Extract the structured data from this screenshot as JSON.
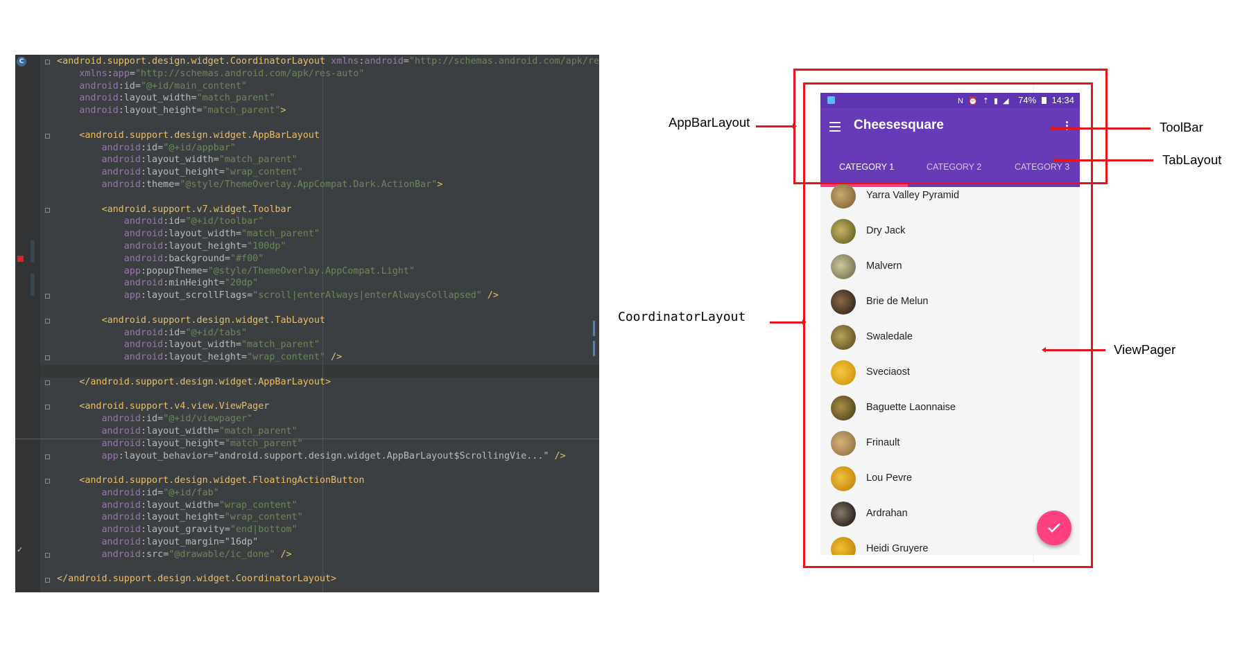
{
  "editor": {
    "lines": [
      {
        "fold": true,
        "parts": [
          [
            "p",
            "<"
          ],
          [
            "t",
            "android.support.design.widget.CoordinatorLayout"
          ],
          [
            "x",
            " "
          ],
          [
            "ns",
            "xmlns"
          ],
          [
            "a",
            ":"
          ],
          [
            "ns",
            "android"
          ],
          [
            "a",
            "="
          ],
          [
            "v",
            "\"http://schemas.android.com/apk/res"
          ]
        ]
      },
      {
        "parts": [
          [
            "x",
            "    "
          ],
          [
            "ns",
            "xmlns"
          ],
          [
            "a",
            ":"
          ],
          [
            "ns",
            "app"
          ],
          [
            "a",
            "="
          ],
          [
            "v",
            "\"http://schemas.android.com/apk/res-auto\""
          ]
        ]
      },
      {
        "parts": [
          [
            "x",
            "    "
          ],
          [
            "ns",
            "android"
          ],
          [
            "a",
            ":id="
          ],
          [
            "v",
            "\"@+id/main_content\""
          ]
        ]
      },
      {
        "parts": [
          [
            "x",
            "    "
          ],
          [
            "ns",
            "android"
          ],
          [
            "a",
            ":layout_width="
          ],
          [
            "v",
            "\"match_parent\""
          ]
        ]
      },
      {
        "parts": [
          [
            "x",
            "    "
          ],
          [
            "ns",
            "android"
          ],
          [
            "a",
            ":layout_height="
          ],
          [
            "v",
            "\"match_parent\""
          ],
          [
            "p",
            ">"
          ]
        ]
      },
      {
        "parts": []
      },
      {
        "fold": true,
        "parts": [
          [
            "x",
            "    "
          ],
          [
            "p",
            "<"
          ],
          [
            "t",
            "android.support.design.widget.AppBarLayout"
          ]
        ]
      },
      {
        "parts": [
          [
            "x",
            "        "
          ],
          [
            "ns",
            "android"
          ],
          [
            "a",
            ":id="
          ],
          [
            "v",
            "\"@+id/appbar\""
          ]
        ]
      },
      {
        "parts": [
          [
            "x",
            "        "
          ],
          [
            "ns",
            "android"
          ],
          [
            "a",
            ":layout_width="
          ],
          [
            "v",
            "\"match_parent\""
          ]
        ]
      },
      {
        "parts": [
          [
            "x",
            "        "
          ],
          [
            "ns",
            "android"
          ],
          [
            "a",
            ":layout_height="
          ],
          [
            "v",
            "\"wrap_content\""
          ]
        ]
      },
      {
        "parts": [
          [
            "x",
            "        "
          ],
          [
            "ns",
            "android"
          ],
          [
            "a",
            ":theme="
          ],
          [
            "v",
            "\"@style/ThemeOverlay.AppCompat.Dark.ActionBar\""
          ],
          [
            "p",
            ">"
          ]
        ]
      },
      {
        "parts": []
      },
      {
        "fold": true,
        "parts": [
          [
            "x",
            "        "
          ],
          [
            "p",
            "<"
          ],
          [
            "t",
            "android.support.v7.widget.Toolbar"
          ]
        ]
      },
      {
        "parts": [
          [
            "x",
            "            "
          ],
          [
            "ns",
            "android"
          ],
          [
            "a",
            ":id="
          ],
          [
            "v",
            "\"@+id/toolbar\""
          ]
        ]
      },
      {
        "parts": [
          [
            "x",
            "            "
          ],
          [
            "ns",
            "android"
          ],
          [
            "a",
            ":layout_width="
          ],
          [
            "v",
            "\"match_parent\""
          ]
        ]
      },
      {
        "parts": [
          [
            "x",
            "            "
          ],
          [
            "ns",
            "android"
          ],
          [
            "a",
            ":layout_height="
          ],
          [
            "v",
            "\"100dp\""
          ]
        ]
      },
      {
        "parts": [
          [
            "x",
            "            "
          ],
          [
            "ns",
            "android"
          ],
          [
            "a",
            ":background="
          ],
          [
            "v",
            "\"#f00\""
          ]
        ]
      },
      {
        "parts": [
          [
            "x",
            "            "
          ],
          [
            "ns",
            "app"
          ],
          [
            "a",
            ":popupTheme="
          ],
          [
            "v",
            "\"@style/ThemeOverlay.AppCompat.Light\""
          ]
        ]
      },
      {
        "parts": [
          [
            "x",
            "            "
          ],
          [
            "ns",
            "android"
          ],
          [
            "a",
            ":minHeight="
          ],
          [
            "v",
            "\"20dp\""
          ]
        ]
      },
      {
        "fold": true,
        "parts": [
          [
            "x",
            "            "
          ],
          [
            "ns",
            "app"
          ],
          [
            "a",
            ":layout_scrollFlags="
          ],
          [
            "v",
            "\"scroll|enterAlways|enterAlwaysCollapsed\""
          ],
          [
            "x",
            " "
          ],
          [
            "p",
            "/>"
          ]
        ]
      },
      {
        "parts": []
      },
      {
        "fold": true,
        "parts": [
          [
            "x",
            "        "
          ],
          [
            "p",
            "<"
          ],
          [
            "t",
            "android.support.design.widget.TabLayout"
          ]
        ]
      },
      {
        "parts": [
          [
            "x",
            "            "
          ],
          [
            "ns",
            "android"
          ],
          [
            "a",
            ":id="
          ],
          [
            "v",
            "\"@+id/tabs\""
          ]
        ]
      },
      {
        "parts": [
          [
            "x",
            "            "
          ],
          [
            "ns",
            "android"
          ],
          [
            "a",
            ":layout_width="
          ],
          [
            "v",
            "\"match_parent\""
          ]
        ]
      },
      {
        "fold": true,
        "parts": [
          [
            "x",
            "            "
          ],
          [
            "ns",
            "android"
          ],
          [
            "a",
            ":layout_height="
          ],
          [
            "v",
            "\"wrap_content\""
          ],
          [
            "x",
            " "
          ],
          [
            "p",
            "/>"
          ]
        ]
      },
      {
        "parts": []
      },
      {
        "fold": true,
        "parts": [
          [
            "x",
            "    "
          ],
          [
            "p",
            "</"
          ],
          [
            "t",
            "android.support.design.widget.AppBarLayout"
          ],
          [
            "p",
            ">"
          ]
        ]
      },
      {
        "parts": []
      },
      {
        "fold": true,
        "parts": [
          [
            "x",
            "    "
          ],
          [
            "p",
            "<"
          ],
          [
            "t",
            "android.support.v4.view.ViewPager"
          ]
        ]
      },
      {
        "parts": [
          [
            "x",
            "        "
          ],
          [
            "ns",
            "android"
          ],
          [
            "a",
            ":id="
          ],
          [
            "v",
            "\"@+id/viewpager\""
          ]
        ]
      },
      {
        "parts": [
          [
            "x",
            "        "
          ],
          [
            "ns",
            "android"
          ],
          [
            "a",
            ":layout_width="
          ],
          [
            "v",
            "\"match_parent\""
          ]
        ]
      },
      {
        "parts": [
          [
            "x",
            "        "
          ],
          [
            "ns",
            "android"
          ],
          [
            "a",
            ":layout_height="
          ],
          [
            "v",
            "\"match_parent\""
          ]
        ]
      },
      {
        "fold": true,
        "parts": [
          [
            "x",
            "        "
          ],
          [
            "ns",
            "app"
          ],
          [
            "a",
            ":layout_behavior="
          ],
          [
            "a",
            "\"android.support.design.widget.AppBarLayout$ScrollingVie...\""
          ],
          [
            "x",
            " "
          ],
          [
            "p",
            "/>"
          ]
        ]
      },
      {
        "parts": []
      },
      {
        "fold": true,
        "parts": [
          [
            "x",
            "    "
          ],
          [
            "p",
            "<"
          ],
          [
            "t",
            "android.support.design.widget.FloatingActionButton"
          ]
        ]
      },
      {
        "parts": [
          [
            "x",
            "        "
          ],
          [
            "ns",
            "android"
          ],
          [
            "a",
            ":id="
          ],
          [
            "v",
            "\"@+id/fab\""
          ]
        ]
      },
      {
        "parts": [
          [
            "x",
            "        "
          ],
          [
            "ns",
            "android"
          ],
          [
            "a",
            ":layout_width="
          ],
          [
            "v",
            "\"wrap_content\""
          ]
        ]
      },
      {
        "parts": [
          [
            "x",
            "        "
          ],
          [
            "ns",
            "android"
          ],
          [
            "a",
            ":layout_height="
          ],
          [
            "v",
            "\"wrap_content\""
          ]
        ]
      },
      {
        "parts": [
          [
            "x",
            "        "
          ],
          [
            "ns",
            "android"
          ],
          [
            "a",
            ":layout_gravity="
          ],
          [
            "v",
            "\"end|bottom\""
          ]
        ]
      },
      {
        "parts": [
          [
            "x",
            "        "
          ],
          [
            "ns",
            "android"
          ],
          [
            "a",
            ":layout_margin="
          ],
          [
            "a",
            "\"16dp\""
          ]
        ]
      },
      {
        "fold": true,
        "parts": [
          [
            "x",
            "        "
          ],
          [
            "ns",
            "android"
          ],
          [
            "a",
            ":src="
          ],
          [
            "v",
            "\"@drawable/ic_done\""
          ],
          [
            "x",
            " "
          ],
          [
            "p",
            "/>"
          ]
        ]
      },
      {
        "parts": []
      },
      {
        "fold": true,
        "parts": [
          [
            "p",
            "</"
          ],
          [
            "t",
            "android.support.design.widget.CoordinatorLayout"
          ],
          [
            "p",
            ">"
          ]
        ]
      }
    ]
  },
  "phone": {
    "status": {
      "icons": "N ⏰ ⇡ ▮ ◢",
      "battery": "74%",
      "time": "14:34"
    },
    "title": "Cheesesquare",
    "tabs": [
      "CATEGORY 1",
      "CATEGORY 2",
      "CATEGORY 3"
    ],
    "cheeses": [
      "Yarra Valley Pyramid",
      "Dry Jack",
      "Malvern",
      "Brie de Melun",
      "Swaledale",
      "Sveciaost",
      "Baguette Laonnaise",
      "Frinault",
      "Lou Pevre",
      "Ardrahan",
      "Heidi Gruyere"
    ]
  },
  "annotations": {
    "appbarlayout": "AppBarLayout",
    "toolbar": "ToolBar",
    "tablayout": "TabLayout",
    "coordinatorlayout": "CoordinatorLayout",
    "viewpager": "ViewPager"
  },
  "colors": {
    "primary": "#673ab7",
    "primary_dark": "#5e35b1",
    "accent": "#ff4081",
    "annotation_red": "#e8131a",
    "editor_bg": "#3c3f41"
  }
}
